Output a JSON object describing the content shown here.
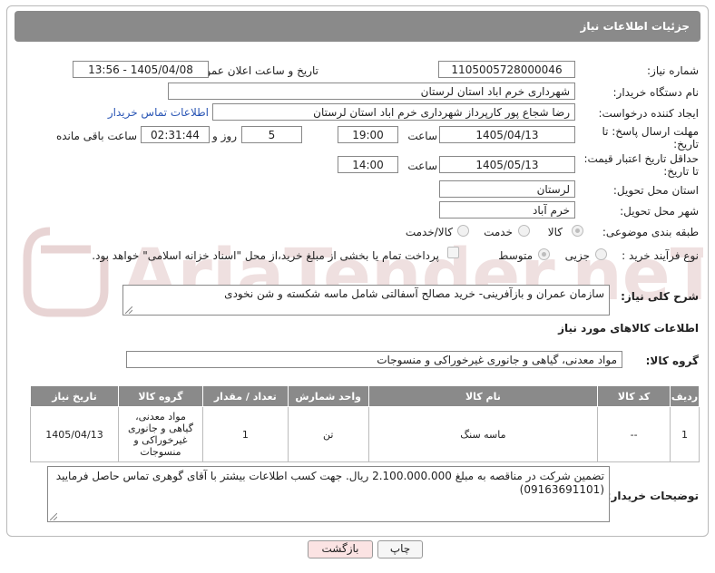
{
  "header": {
    "title": "جزئیات اطلاعات نیاز"
  },
  "fields": {
    "need_number_label": "شماره نیاز:",
    "need_number": "1105005728000046",
    "announce_label": "تاریخ و ساعت اعلان عمومی:",
    "announce_value": "1405/04/08 - 13:56",
    "buyer_org_label": "نام دستگاه خریدار:",
    "buyer_org": "شهرداری خرم اباد استان لرستان",
    "creator_label": "ایجاد کننده درخواست:",
    "creator": "رضا شجاع پور کارپرداز شهرداری خرم اباد استان لرستان",
    "contact_link": "اطلاعات تماس خریدار",
    "deadline_label_1": "مهلت ارسال پاسخ: تا",
    "deadline_label_2": "تاریخ:",
    "deadline_date": "1405/04/13",
    "time_label": "ساعت",
    "deadline_time": "19:00",
    "days_value": "5",
    "days_label": "روز و",
    "remaining_time": "02:31:44",
    "remaining_label": "ساعت باقی مانده",
    "min_validity_label_1": "حداقل تاریخ اعتبار قیمت:",
    "min_validity_label_2": "تا تاریخ:",
    "validity_date": "1405/05/13",
    "validity_time": "14:00",
    "province_label": "استان محل تحویل:",
    "province": "لرستان",
    "city_label": "شهر محل تحویل:",
    "city": "خرم آباد",
    "category_label": "طبقه بندی موضوعی:",
    "category_options": [
      "کالا",
      "خدمت",
      "کالا/خدمت"
    ],
    "process_label": "نوع فرآیند خرید :",
    "process_options": [
      "جزیی",
      "متوسط"
    ],
    "payment_note": "پرداخت تمام یا بخشی از مبلغ خرید،از محل \"اسناد خزانه اسلامی\" خواهد بود."
  },
  "description": {
    "label": "شرح کلی نیاز:",
    "text": "سازمان عمران و بازآفرینی- خرید مصالح آسفالتی شامل ماسه شکسته و شن نخودی"
  },
  "goods": {
    "section_title": "اطلاعات کالاهای مورد نیاز",
    "group_label": "گروه کالا:",
    "group_value": "مواد معدنی، گیاهی و جانوری غیرخوراکی و منسوجات"
  },
  "table": {
    "headers": [
      "ردیف",
      "کد کالا",
      "نام کالا",
      "واحد شمارش",
      "تعداد / مقدار",
      "گروه کالا",
      "تاریخ نیاز"
    ],
    "rows": [
      {
        "row": "1",
        "code": "--",
        "name": "ماسه سنگ",
        "unit": "تن",
        "qty": "1",
        "group_lines": [
          "مواد معدنی،",
          "گیاهی و جانوری",
          "غیرخوراکی و",
          "منسوجات"
        ],
        "date": "1405/04/13"
      }
    ]
  },
  "buyer_notes": {
    "label": "توضیحات خریدار:",
    "line1": "تضمین شرکت در مناقصه به مبلغ 2.100.000.000 ریال. جهت کسب اطلاعات بیشتر با آقای گوهری تماس حاصل فرمایید",
    "line2": "(09163691101)"
  },
  "buttons": {
    "print": "چاپ",
    "back": "بازگشت"
  },
  "watermark": {
    "text": "AriaTender.neT"
  },
  "colors": {
    "header_bg": "#8a8a8a",
    "link": "#2a56b5",
    "back_button_bg": "#fbe3e3",
    "watermark": "#e8d4d4"
  }
}
